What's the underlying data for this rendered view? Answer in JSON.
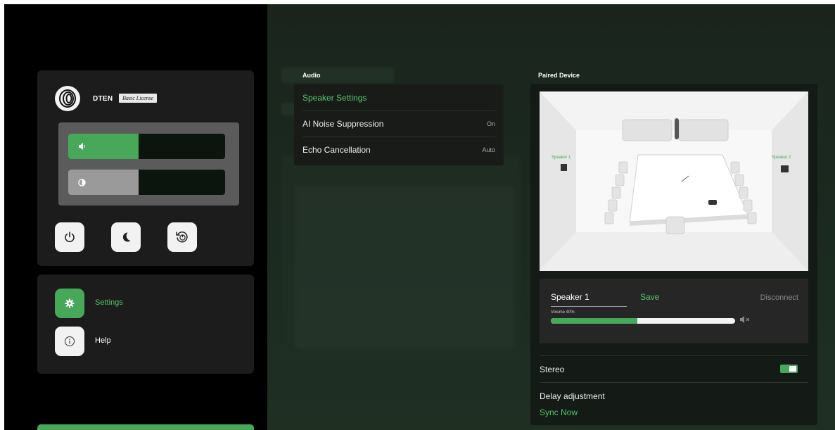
{
  "device": {
    "brand": "DTEN",
    "license": "Basic License"
  },
  "controls": {
    "volume_level": 0.45,
    "brightness_level": 0.45
  },
  "menu": {
    "settings_label": "Settings",
    "help_label": "Help"
  },
  "audio": {
    "section_title": "Audio",
    "items": [
      {
        "label": "Speaker Settings",
        "value": ""
      },
      {
        "label": "AI Noise Suppression",
        "value": "On"
      },
      {
        "label": "Echo Cancellation",
        "value": "Auto"
      }
    ]
  },
  "paired": {
    "section_title": "Paired Device",
    "speaker1_label": "Speaker 1",
    "speaker2_label": "Speaker 2",
    "speaker_name": "Speaker 1",
    "save_label": "Save",
    "disconnect_label": "Disconnect",
    "volume_label": "Volume 40%",
    "volume_value": 0.47,
    "stereo_label": "Stereo",
    "stereo_on": true,
    "delay_label": "Delay adjustment",
    "sync_label": "Sync Now"
  },
  "colors": {
    "accent": "#48a85a",
    "accent_text": "#55c46a",
    "panel": "#1c1c1c",
    "background": "#000000"
  }
}
